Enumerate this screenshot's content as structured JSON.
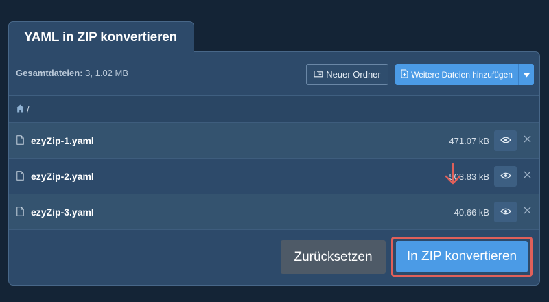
{
  "header": {
    "title": "YAML in ZIP konvertieren"
  },
  "toolbar": {
    "stats_label": "Gesamtdateien:",
    "stats_value": " 3, 1.02 MB",
    "new_folder_label": "Neuer Ordner",
    "add_files_label": "Weitere Dateien hinzufügen"
  },
  "breadcrumb": {
    "separator": "/"
  },
  "files": [
    {
      "name": "ezyZip-1.yaml",
      "size": "471.07 kB"
    },
    {
      "name": "ezyZip-2.yaml",
      "size": "503.83 kB"
    },
    {
      "name": "ezyZip-3.yaml",
      "size": "40.66 kB"
    }
  ],
  "footer": {
    "reset_label": "Zurücksetzen",
    "convert_label": "In ZIP konvertieren"
  },
  "colors": {
    "background": "#142436",
    "panel": "#2d4a6a",
    "primary": "#4b9be6",
    "highlight": "#e0605a",
    "reset": "#4e5a67"
  },
  "icons": [
    "folder-plus-icon",
    "file-plus-icon",
    "caret-down-icon",
    "home-icon",
    "file-icon",
    "eye-icon",
    "close-icon",
    "arrow-down-icon"
  ]
}
